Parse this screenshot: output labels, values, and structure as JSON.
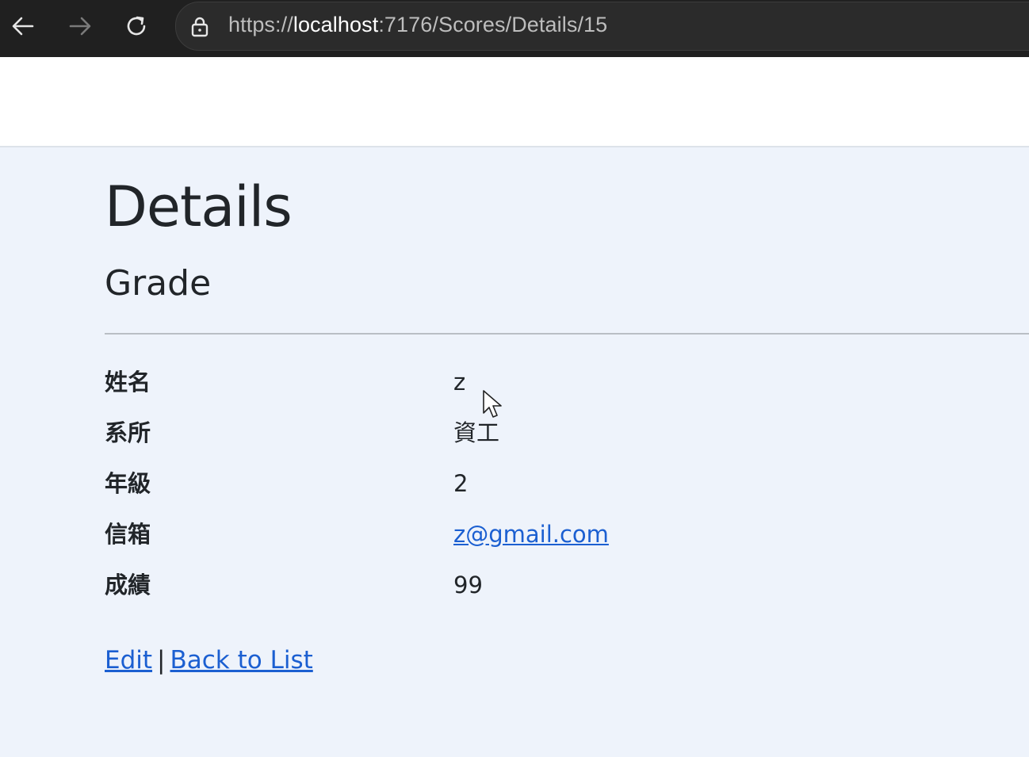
{
  "browser": {
    "url_scheme": "https://",
    "url_host": "localhost",
    "url_rest": ":7176/Scores/Details/15",
    "icons": {
      "back": "arrow-left-icon",
      "forward": "arrow-right-icon",
      "reload": "reload-icon",
      "lock": "lock-icon"
    }
  },
  "page": {
    "title": "Details",
    "subtitle": "Grade"
  },
  "details": [
    {
      "label": "姓名",
      "value": "z"
    },
    {
      "label": "系所",
      "value": "資工"
    },
    {
      "label": "年級",
      "value": "2"
    },
    {
      "label": "信箱",
      "value": "z@gmail.com"
    },
    {
      "label": "成績",
      "value": "99"
    }
  ],
  "actions": {
    "edit_label": "Edit",
    "separator": "|",
    "back_label": "Back to List"
  },
  "colors": {
    "link": "#1b5fd1",
    "page_background": "#eef3fb",
    "browser_chrome": "#202020"
  }
}
